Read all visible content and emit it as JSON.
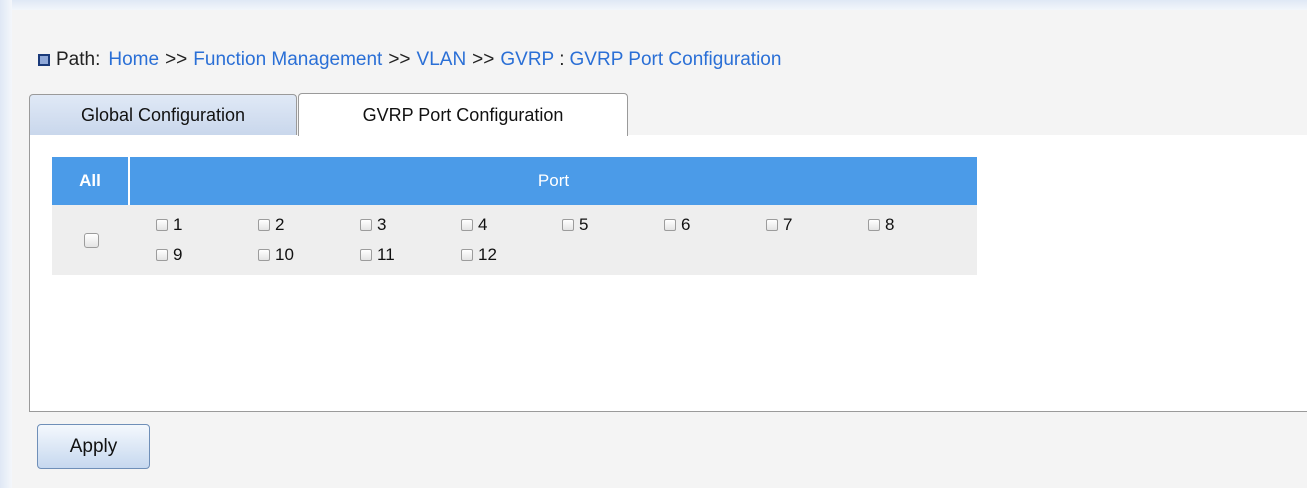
{
  "breadcrumb": {
    "label": "Path:",
    "home": "Home",
    "sep1": ">>",
    "function_management": "Function Management",
    "sep2": ">>",
    "vlan": "VLAN",
    "sep3": ">>",
    "gvrp": "GVRP",
    "colon": ":",
    "current": "GVRP Port Configuration"
  },
  "tabs": [
    {
      "label": "Global Configuration",
      "active": false
    },
    {
      "label": "GVRP Port Configuration",
      "active": true
    }
  ],
  "table": {
    "header_all": "All",
    "header_port": "Port",
    "all_checked": false,
    "ports": [
      {
        "label": "1",
        "checked": false
      },
      {
        "label": "2",
        "checked": false
      },
      {
        "label": "3",
        "checked": false
      },
      {
        "label": "4",
        "checked": false
      },
      {
        "label": "5",
        "checked": false
      },
      {
        "label": "6",
        "checked": false
      },
      {
        "label": "7",
        "checked": false
      },
      {
        "label": "8",
        "checked": false
      },
      {
        "label": "9",
        "checked": false
      },
      {
        "label": "10",
        "checked": false
      },
      {
        "label": "11",
        "checked": false
      },
      {
        "label": "12",
        "checked": false
      }
    ]
  },
  "actions": {
    "apply_label": "Apply"
  },
  "colors": {
    "accent": "#4b9be8",
    "link": "#2a6fd6"
  },
  "icons": {
    "path": "square-bullet-icon",
    "checkbox": "checkbox-icon"
  }
}
